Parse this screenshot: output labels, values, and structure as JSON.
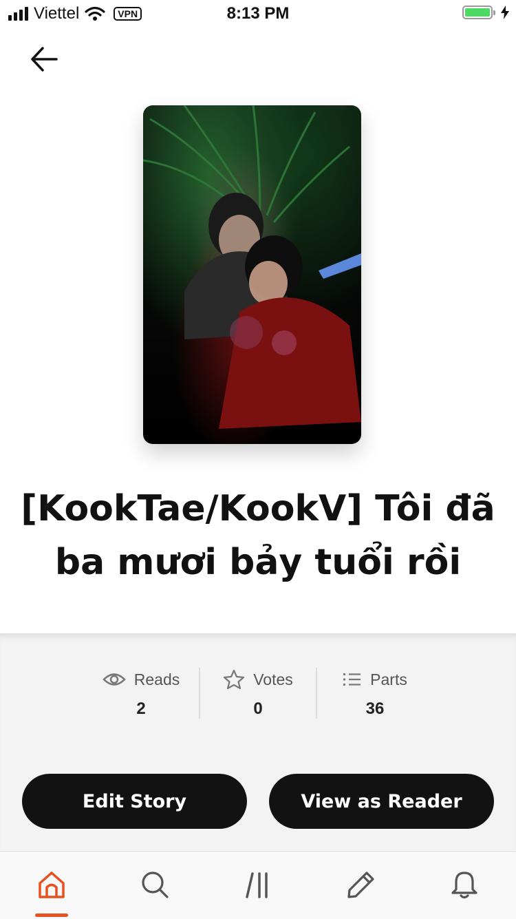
{
  "status_bar": {
    "carrier": "Viettel",
    "vpn": "VPN",
    "time": "8:13 PM",
    "battery_color": "#4cd964"
  },
  "header": {
    "back_icon": "arrow-left-icon"
  },
  "story": {
    "title": "[KookTae/KookV] Tôi đã ba mươi bảy tuổi rồi"
  },
  "stats": [
    {
      "icon": "eye-icon",
      "label": "Reads",
      "value": "2"
    },
    {
      "icon": "star-icon",
      "label": "Votes",
      "value": "0"
    },
    {
      "icon": "list-icon",
      "label": "Parts",
      "value": "36"
    }
  ],
  "actions": {
    "edit_label": "Edit Story",
    "view_label": "View as Reader"
  },
  "tab_bar": {
    "items": [
      {
        "icon": "home-icon",
        "active": true
      },
      {
        "icon": "search-icon",
        "active": false
      },
      {
        "icon": "library-icon",
        "active": false
      },
      {
        "icon": "pencil-icon",
        "active": false
      },
      {
        "icon": "bell-icon",
        "active": false
      }
    ],
    "accent": "#e8501f",
    "inactive_color": "#555555"
  }
}
